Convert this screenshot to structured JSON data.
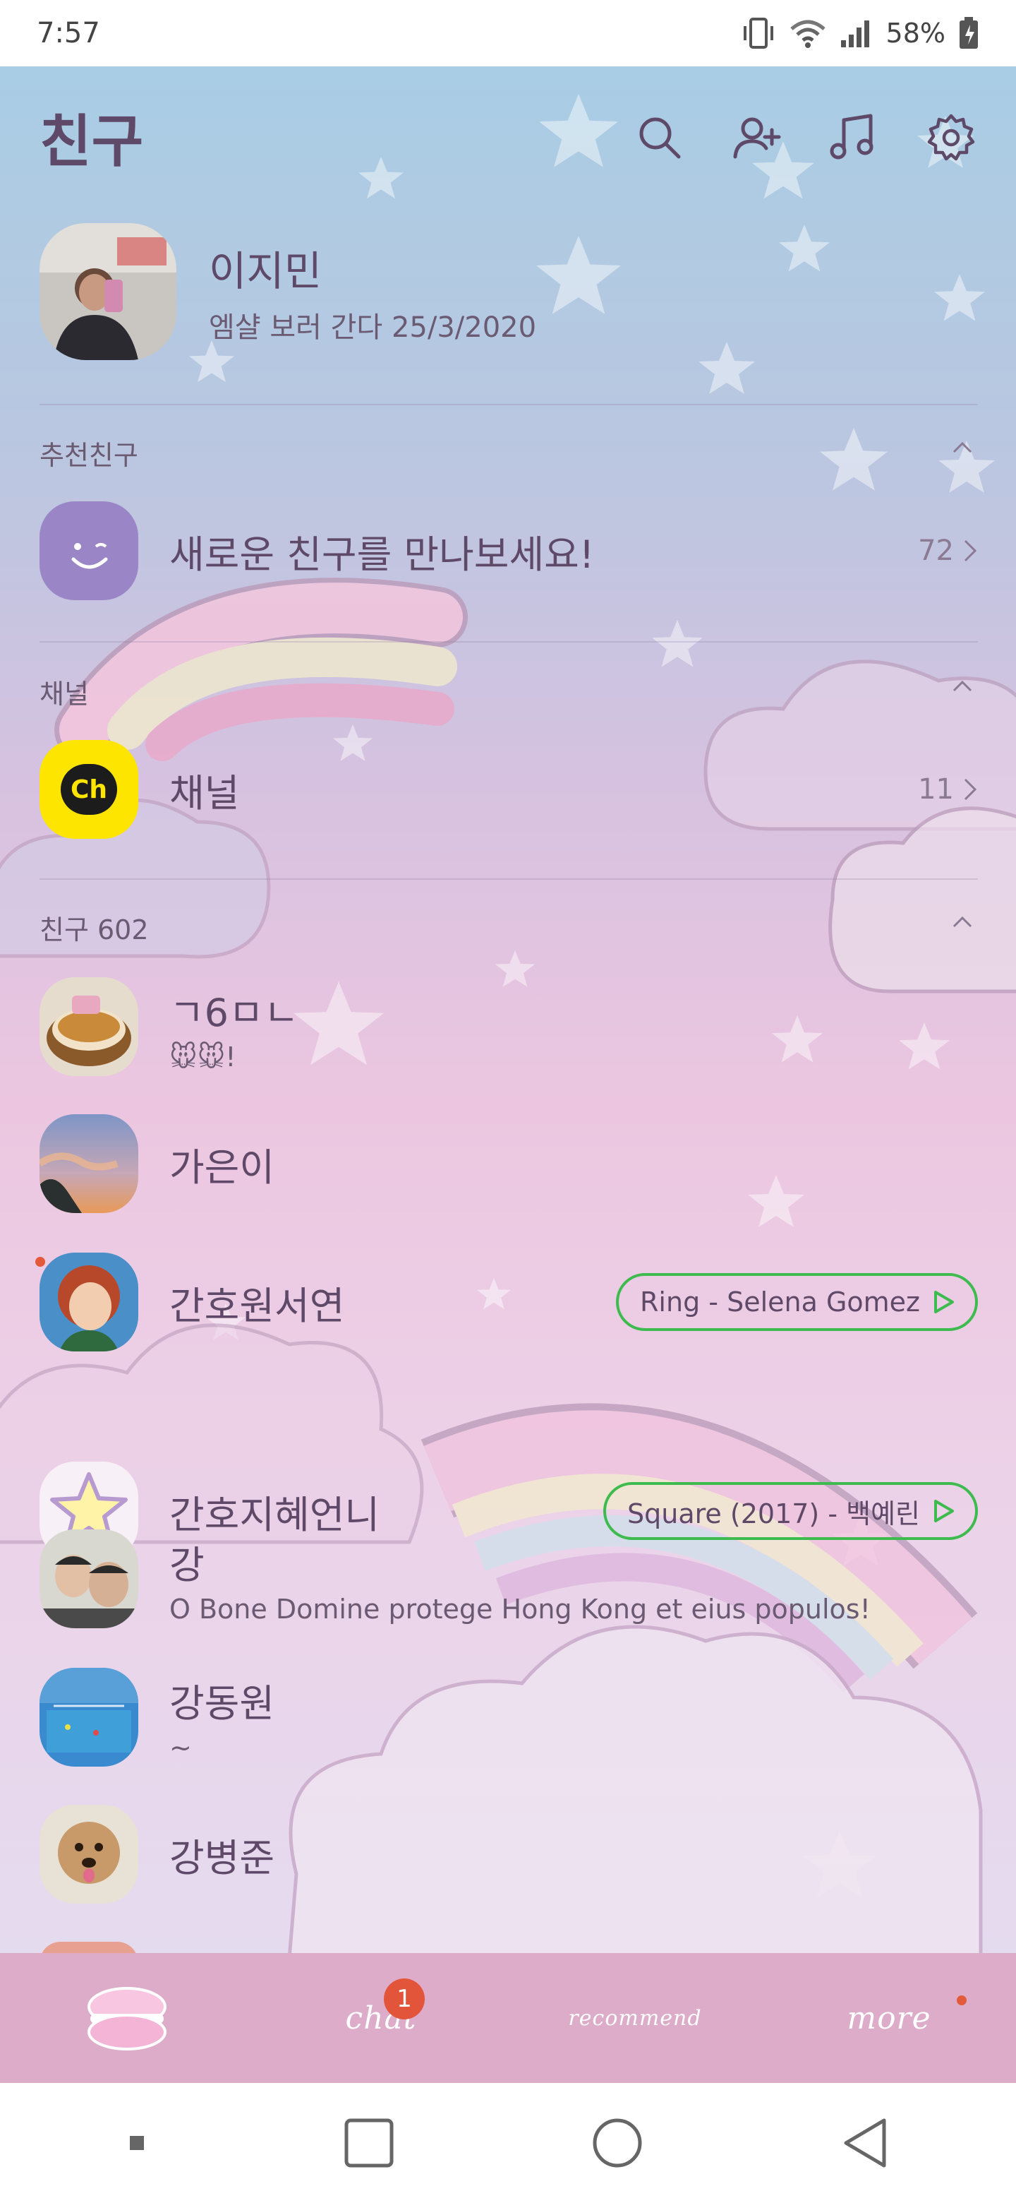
{
  "status": {
    "time": "7:57",
    "battery": "58%"
  },
  "header": {
    "title": "친구"
  },
  "me": {
    "name": "이지민",
    "status": "엠샬 보러 간다 25/3/2020"
  },
  "sections": {
    "recommended": {
      "label": "추천친구",
      "item": {
        "name": "새로운 친구를 만나보세요!",
        "count": "72"
      }
    },
    "channels": {
      "label": "채널",
      "item": {
        "name": "채널",
        "count": "11",
        "logo_text": "Ch"
      }
    },
    "friends": {
      "label": "친구 602"
    }
  },
  "friends": [
    {
      "name": "ㄱ6ㅁㄴ",
      "status": "🐭🐭!"
    },
    {
      "name": "가은이",
      "status": ""
    },
    {
      "name": "간호원서연",
      "music": "Ring - Selena Gomez"
    },
    {
      "name": "간호지혜언니",
      "music": "Square (2017) - 백예린"
    },
    {
      "name": "강",
      "status": "O Bone Domine protege Hong Kong et eius populos!"
    },
    {
      "name": "강동원",
      "status": "~"
    },
    {
      "name": "강병준",
      "status": ""
    }
  ],
  "tabs": [
    {
      "label": "",
      "icon": "macaron-icon"
    },
    {
      "label": "chat",
      "badge": "1"
    },
    {
      "label": "recommend"
    },
    {
      "label": "more"
    }
  ],
  "colors": {
    "accent": "#5e4a68",
    "music_border": "#3dbb4e",
    "badge": "#e2553b",
    "tab_bar": "#dcacc9"
  }
}
